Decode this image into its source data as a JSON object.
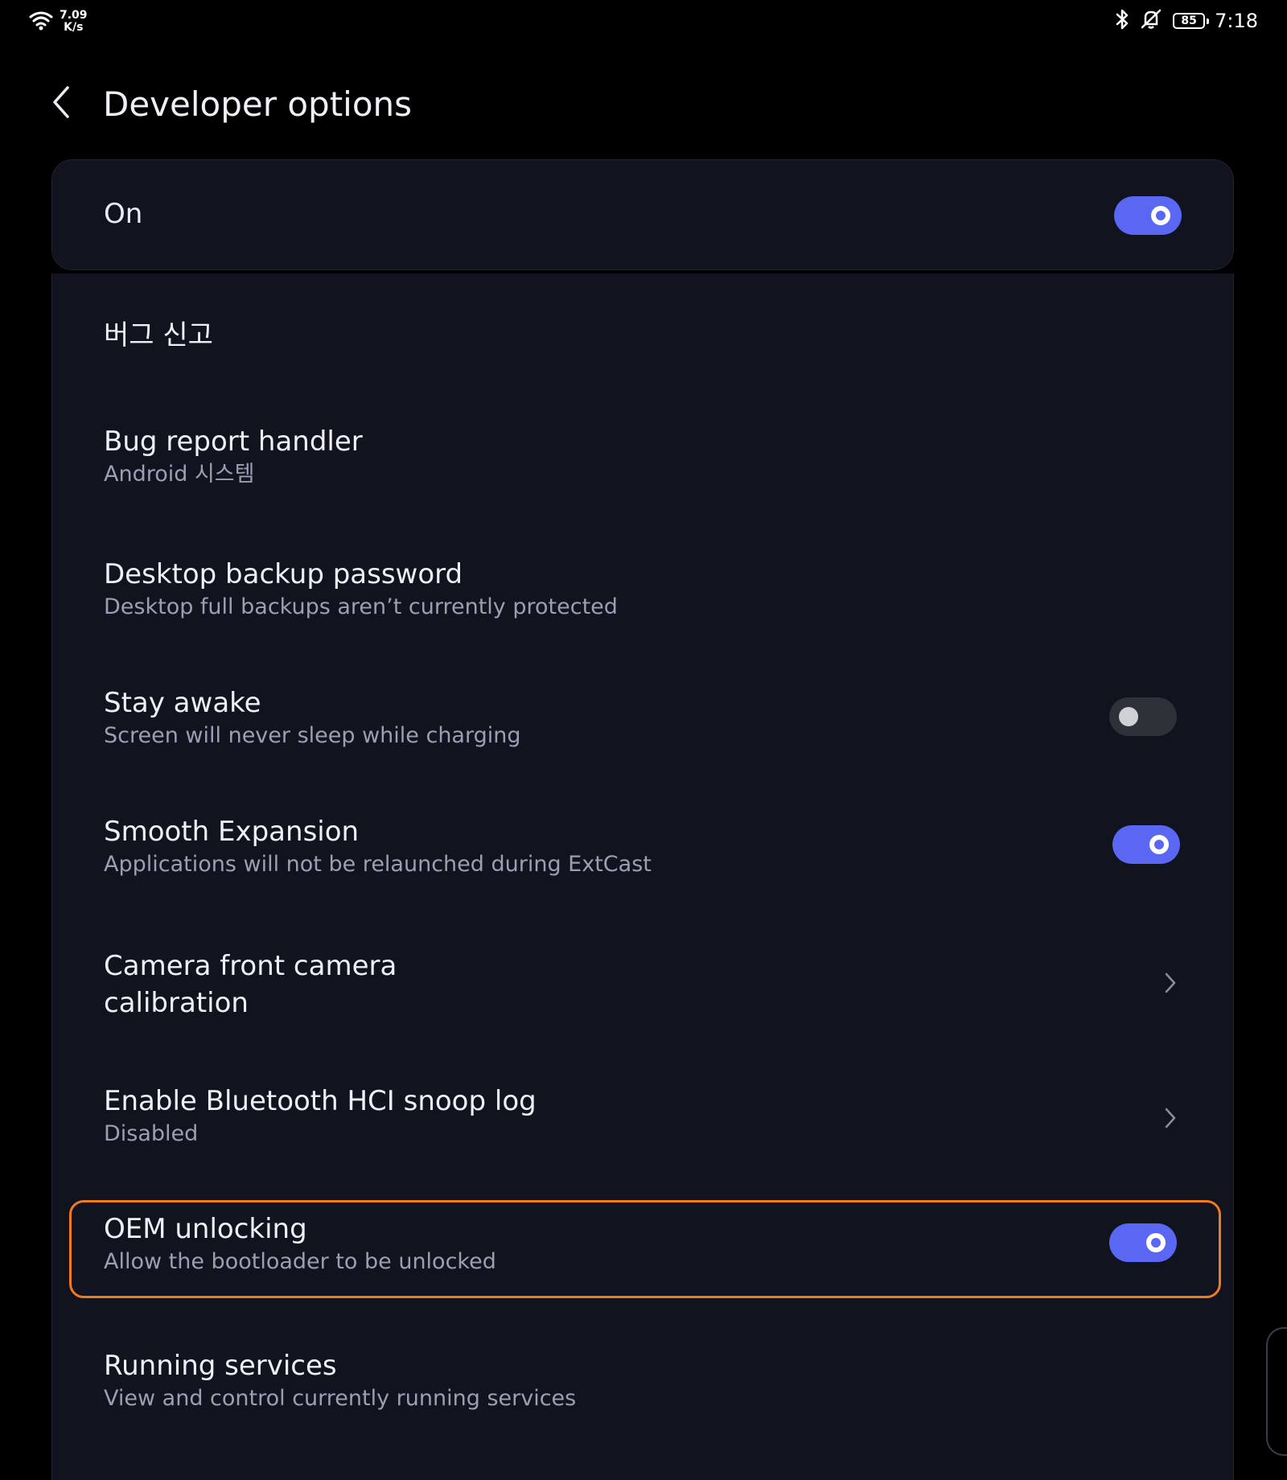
{
  "status_bar": {
    "net_speed_value": "7.09",
    "net_speed_unit": "K/s",
    "battery_level": "85",
    "time": "7:18",
    "icons": [
      "wifi-icon",
      "bluetooth-icon",
      "notifications-off-icon",
      "battery-icon"
    ]
  },
  "header": {
    "title": "Developer options",
    "back_icon": "back-arrow-icon"
  },
  "master_switch": {
    "label": "On",
    "state": true
  },
  "items": [
    {
      "title": "버그 신고"
    },
    {
      "title": "Bug report handler",
      "subtitle": "Android 시스템"
    },
    {
      "title": "Desktop backup password",
      "subtitle": "Desktop full backups aren’t currently protected"
    },
    {
      "title": "Stay awake",
      "subtitle": "Screen will never sleep while charging",
      "toggle": false
    },
    {
      "title": "Smooth Expansion",
      "subtitle": "Applications will not be relaunched during ExtCast",
      "toggle": true
    },
    {
      "title_line1": "Camera front camera",
      "title_line2": "calibration",
      "chevron": true
    },
    {
      "title": "Enable Bluetooth HCI snoop log",
      "subtitle": "Disabled",
      "chevron": true
    },
    {
      "title": "OEM unlocking",
      "subtitle": "Allow the bootloader to be unlocked",
      "toggle": true,
      "highlighted": true
    },
    {
      "title": "Running services",
      "subtitle": "View and control currently running services"
    }
  ],
  "colors": {
    "accent": "#5a67f2",
    "highlight": "#f07a1e",
    "card_background": "#11131f",
    "page_background": "#000000"
  }
}
